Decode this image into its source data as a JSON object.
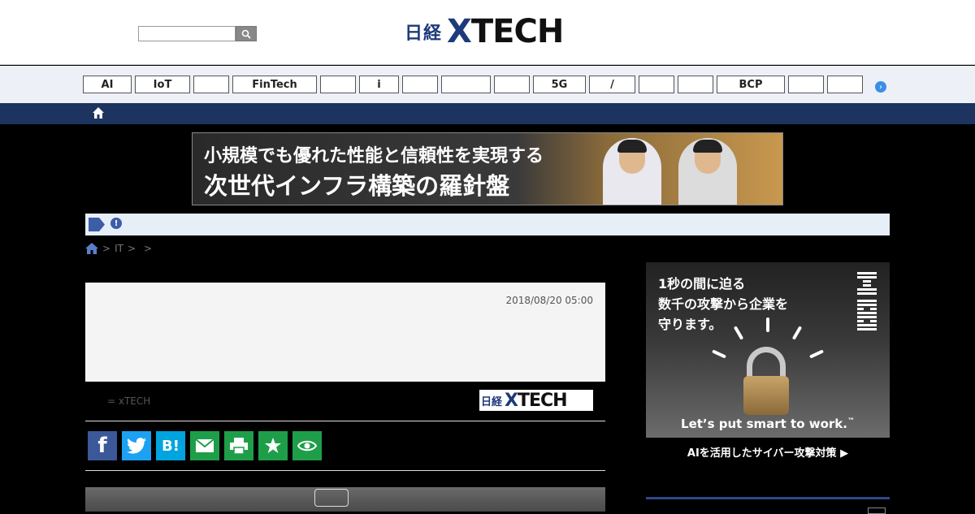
{
  "header": {
    "search": {
      "placeholder": ""
    },
    "logo": {
      "jp": "日経",
      "x": "X",
      "tech": "TECH"
    }
  },
  "nav": {
    "items": [
      {
        "label": "AI"
      },
      {
        "label": "IoT"
      },
      {
        "label": ""
      },
      {
        "label": "FinTech"
      },
      {
        "label": ""
      },
      {
        "label": "i"
      },
      {
        "label": ""
      },
      {
        "label": ""
      },
      {
        "label": ""
      },
      {
        "label": "5G"
      },
      {
        "label": "/"
      },
      {
        "label": ""
      },
      {
        "label": ""
      },
      {
        "label": "BCP"
      },
      {
        "label": ""
      },
      {
        "label": ""
      }
    ]
  },
  "banner": {
    "line1": "小規模でも優れた性能と信頼性を実現する",
    "line2": "次世代インフラ構築の羅針盤"
  },
  "breadcrumb": {
    "items": [
      "IT"
    ]
  },
  "article": {
    "date": "2018/08/20 05:00",
    "credit": "= xTECH",
    "small_logo_jp": "日経",
    "small_logo_x": "X",
    "small_logo_tech": "TECH"
  },
  "share": {
    "facebook": "f",
    "hatena": "B!"
  },
  "side_ad": {
    "line1": "1秒の間に迫る",
    "line2": "数千の攻撃から企業を",
    "line3": "守ります。",
    "tagline": "Let’s put smart to work.",
    "tagline_mark": "™",
    "cta": "AIを活用したサイバー攻撃対策 ▶"
  }
}
